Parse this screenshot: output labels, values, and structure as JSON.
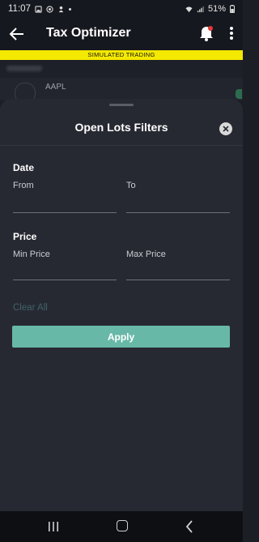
{
  "status_bar": {
    "time": "11:07",
    "battery": "51%"
  },
  "app_bar": {
    "title": "Tax Optimizer"
  },
  "banner": {
    "text": "SIMULATED TRADING"
  },
  "background_list": {
    "symbol": "AAPL"
  },
  "sheet": {
    "title": "Open Lots Filters",
    "date_section": {
      "label": "Date",
      "from_label": "From",
      "from_value": "",
      "to_label": "To",
      "to_value": ""
    },
    "price_section": {
      "label": "Price",
      "min_label": "Min Price",
      "min_value": "",
      "max_label": "Max Price",
      "max_value": ""
    },
    "clear_all_label": "Clear All",
    "apply_label": "Apply"
  },
  "colors": {
    "banner": "#f4e900",
    "apply": "#68b8a8",
    "sheet_bg": "#272932",
    "notification_dot": "#e53935"
  },
  "icons": [
    "back-arrow-icon",
    "bell-icon",
    "more-vertical-icon",
    "close-icon",
    "recents-icon",
    "home-icon",
    "nav-back-icon"
  ]
}
